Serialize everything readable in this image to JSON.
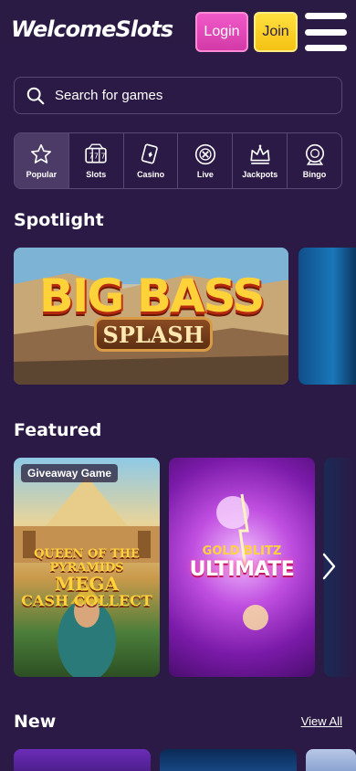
{
  "header": {
    "logo": "WelcomeSlots",
    "login_label": "Login",
    "join_label": "Join",
    "menu_icon": "hamburger-menu-icon",
    "login_color": "#e24bbd",
    "join_color": "#f8d02a"
  },
  "search": {
    "placeholder": "Search for games",
    "icon": "search-icon"
  },
  "categories": [
    {
      "label": "Popular",
      "icon": "star-icon",
      "active": true
    },
    {
      "label": "Slots",
      "icon": "slot-machine-icon",
      "active": false
    },
    {
      "label": "Casino",
      "icon": "playing-cards-icon",
      "active": false
    },
    {
      "label": "Live",
      "icon": "live-chip-icon",
      "active": false
    },
    {
      "label": "Jackpots",
      "icon": "crown-icon",
      "active": false
    },
    {
      "label": "Bingo",
      "icon": "bingo-ball-icon",
      "active": false
    }
  ],
  "spotlight": {
    "title": "Spotlight",
    "cards": [
      {
        "logo_line1": "BIG BASS",
        "logo_line2": "SPLASH"
      }
    ]
  },
  "featured": {
    "title": "Featured",
    "cards": [
      {
        "badge": "Giveaway Game",
        "title_line1": "QUEEN OF THE PYRAMIDS",
        "title_line2": "MEGA",
        "title_line3": "CASH COLLECT"
      },
      {
        "title_line1": "GOLD BLITZ",
        "title_line2": "ULTIMATE"
      }
    ],
    "next_icon": "chevron-right-icon"
  },
  "new": {
    "title": "New",
    "view_all_label": "View All"
  },
  "colors": {
    "background": "#2b1a45",
    "border": "#5a4775",
    "active_tab": "#4b3b66"
  }
}
